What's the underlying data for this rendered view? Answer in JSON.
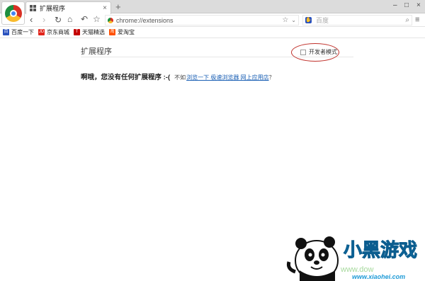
{
  "tab": {
    "title": "扩展程序",
    "close": "×",
    "new_tab": "+"
  },
  "window": {
    "minimize": "–",
    "maximize": "□",
    "close": "×"
  },
  "nav": {
    "back": "‹",
    "forward": "›",
    "reload": "↻",
    "home": "⌂",
    "undo": "↶",
    "star": "☆"
  },
  "address": {
    "url": "chrome://extensions",
    "star": "☆",
    "dropdown": "⌄"
  },
  "search": {
    "placeholder": "百度",
    "engine_icon": "paw",
    "search_icon": "⌕"
  },
  "menu_icon": "≡",
  "bookmarks": [
    {
      "label": "百度一下",
      "icon_text": "百",
      "color": "#2a52be"
    },
    {
      "label": "京东商城",
      "icon_text": "JD",
      "color": "#e1251b"
    },
    {
      "label": "天猫精选",
      "icon_text": "T",
      "color": "#c40000"
    },
    {
      "label": "爱淘宝",
      "icon_text": "淘",
      "color": "#ff5000"
    }
  ],
  "page": {
    "title": "扩展程序",
    "developer_mode": {
      "label": "开发者模式",
      "checked": false
    },
    "empty_message": "啊哦，您没有任何扩展程序 :-(",
    "suggestion_prefix": "不如",
    "suggestion_link": "浏览一下 极速浏览器 网上应用店",
    "suggestion_suffix": "？"
  },
  "watermark": {
    "title": "小黑游戏",
    "url": "www.xiaohei.com",
    "partial_url": "www.dow"
  },
  "colors": {
    "annotation": "#c0302a",
    "link": "#1a5fb4",
    "watermark_blue": "#1f9bd7"
  }
}
